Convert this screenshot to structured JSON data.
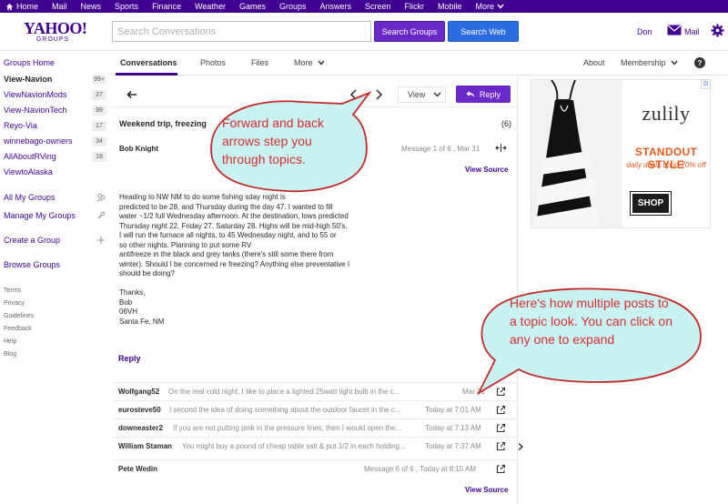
{
  "topnav": {
    "items": [
      "Home",
      "Mail",
      "News",
      "Sports",
      "Finance",
      "Weather",
      "Games",
      "Groups",
      "Answers",
      "Screen",
      "Flickr",
      "Mobile",
      "More"
    ]
  },
  "header": {
    "logo_main": "YAHOO!",
    "logo_sub": "GROUPS",
    "search_placeholder": "Search Conversations",
    "search_groups_label": "Search Groups",
    "search_web_label": "Search Web",
    "user_name": "Don",
    "mail_label": "Mail"
  },
  "sidebar": {
    "groups_home": "Groups Home",
    "groups": [
      {
        "name": "View-Navion",
        "count": "99+",
        "current": true
      },
      {
        "name": "ViewNavionMods",
        "count": "27"
      },
      {
        "name": "View-NavionTech",
        "count": "99"
      },
      {
        "name": "Reyo-Via",
        "count": "17"
      },
      {
        "name": "winnebago-owners",
        "count": "34"
      },
      {
        "name": "AllAboutRVing",
        "count": "18"
      },
      {
        "name": "ViewtoAlaska",
        "count": ""
      }
    ],
    "my_groups": "All My Groups",
    "manage_groups": "Manage My Groups",
    "create_group": "Create a Group",
    "browse_groups": "Browse Groups",
    "footer_links": [
      "Terms",
      "Privacy",
      "Guidelines",
      "Feedback",
      "Help",
      "Blog"
    ]
  },
  "tabs": {
    "items": [
      "Conversations",
      "Photos",
      "Files",
      "More"
    ],
    "about": "About",
    "membership": "Membership",
    "help": "?"
  },
  "toolbar": {
    "view_label": "View",
    "reply_label": "Reply"
  },
  "topic": {
    "title": "Weekend trip, freezing",
    "count": "(6)",
    "author": "Bob Knight",
    "meta": "Message 1 of 6 , Mar 31",
    "view_source": "View Source",
    "body": "Heading to NW NM to do some fishing                         sday night is\npredicted to be 28, and Thursday during the day 47. I wanted to fill\nwater ~1/2 full Wednesday afternoon. At the destination, lows predicted\nThursday night 22, Friday 27, Saturday 28. Highs will be mid-high 50's.\nI will run the furnace all nights, to 45 Wednesday night, and to 55 or\nso other nights. Planning to put some RV\nantifreeze in the black and grey tanks (there's still some there from\nwinter). Should I be concerned re freezing? Anything else preventative I\nshould be doing?\n\nThanks,\nBob\n06VH\nSanta Fe, NM",
    "reply_link": "Reply"
  },
  "posts": [
    {
      "author": "Wolfgang52",
      "snippet": "On the real cold night, I like to place a lighted 25watt light bulb in the c...",
      "time": "Mar 31"
    },
    {
      "author": "eurosteve50",
      "snippet": "I second the idea of doing something about the outdoor faucet in the c...",
      "time": "Today at 7:01 AM"
    },
    {
      "author": "downeaster2",
      "snippet": "If you are not putting pink in the pressure lines, then I would open the...",
      "time": "Today at 7:13 AM"
    },
    {
      "author": "William Staman",
      "snippet": "You might buy a pound of cheap table salt & put 1/2 in each holding...",
      "time": "Today at 7:37 AM"
    },
    {
      "author": "Pete Wedin",
      "snippet": "",
      "time": "Message 6 of 6 , Today at 8:15 AM"
    }
  ],
  "footer_view_source": "View Source",
  "ad": {
    "brand": "zulily",
    "headline": "STANDOUT STYLE",
    "sub": "daily deals up to 70% off",
    "cta": "SHOP",
    "choice": "D"
  },
  "callouts": {
    "nav": "Forward and back arrows step you through topics.",
    "posts": "Here's how multiple posts to a topic look.  You can click on any one to expand"
  },
  "colors": {
    "brand_purple": "#400090",
    "button_purple": "#6a28c8",
    "web_blue": "#2b6de0",
    "callout_fill": "#c9f2f3",
    "callout_stroke": "#c62828",
    "callout_text": "#d32f2f"
  }
}
